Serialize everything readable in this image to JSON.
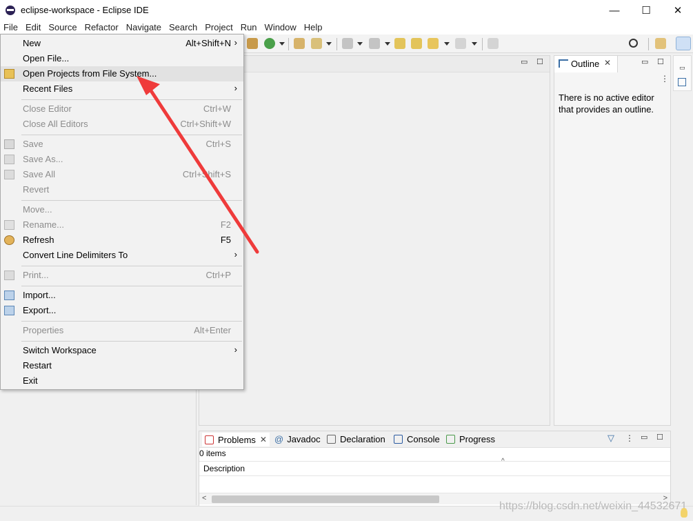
{
  "window": {
    "title": "eclipse-workspace - Eclipse IDE",
    "minimize": "—",
    "maximize": "☐",
    "close": "✕"
  },
  "menubar": [
    "File",
    "Edit",
    "Source",
    "Refactor",
    "Navigate",
    "Search",
    "Project",
    "Run",
    "Window",
    "Help"
  ],
  "file_menu": {
    "new": {
      "label": "New",
      "shortcut": "Alt+Shift+N"
    },
    "open_file": {
      "label": "Open File..."
    },
    "open_projects": {
      "label": "Open Projects from File System..."
    },
    "recent_files": {
      "label": "Recent Files"
    },
    "close_editor": {
      "label": "Close Editor",
      "shortcut": "Ctrl+W"
    },
    "close_all_editors": {
      "label": "Close All Editors",
      "shortcut": "Ctrl+Shift+W"
    },
    "save": {
      "label": "Save",
      "shortcut": "Ctrl+S"
    },
    "save_as": {
      "label": "Save As..."
    },
    "save_all": {
      "label": "Save All",
      "shortcut": "Ctrl+Shift+S"
    },
    "revert": {
      "label": "Revert"
    },
    "move": {
      "label": "Move..."
    },
    "rename": {
      "label": "Rename...",
      "shortcut": "F2"
    },
    "refresh": {
      "label": "Refresh",
      "shortcut": "F5"
    },
    "convert_line_delimiters": {
      "label": "Convert Line Delimiters To"
    },
    "print": {
      "label": "Print...",
      "shortcut": "Ctrl+P"
    },
    "import": {
      "label": "Import..."
    },
    "export": {
      "label": "Export..."
    },
    "properties": {
      "label": "Properties",
      "shortcut": "Alt+Enter"
    },
    "switch_workspace": {
      "label": "Switch Workspace"
    },
    "restart": {
      "label": "Restart"
    },
    "exit": {
      "label": "Exit"
    }
  },
  "submenu_glyph": "›",
  "outline": {
    "tab_label": "Outline",
    "message": "There is no active editor that provides an outline."
  },
  "problems_view": {
    "tabs": [
      "Problems",
      "Javadoc",
      "Declaration",
      "Console",
      "Progress"
    ],
    "javadoc_prefix": "@",
    "items_count": "0 items",
    "column_description": "Description"
  },
  "status": {
    "watermark": "https://blog.csdn.net/weixin_44532671"
  },
  "colors": {
    "annotation_arrow": "#ef3b3b",
    "menu_background": "#f2f2f2",
    "disabled_text": "#8c8c8c"
  },
  "icons": [
    "eclipse-logo-icon",
    "open-folder-icon",
    "save-icon",
    "refresh-icon",
    "import-icon",
    "export-icon",
    "search-icon",
    "filter-icon",
    "outline-icon"
  ]
}
